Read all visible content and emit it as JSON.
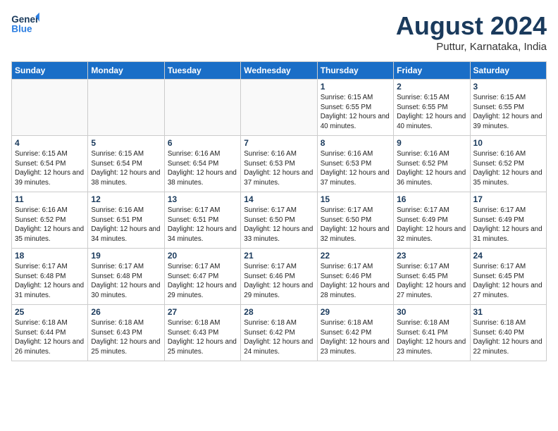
{
  "header": {
    "logo_line1": "General",
    "logo_line2": "Blue",
    "month_title": "August 2024",
    "location": "Puttur, Karnataka, India"
  },
  "days_of_week": [
    "Sunday",
    "Monday",
    "Tuesday",
    "Wednesday",
    "Thursday",
    "Friday",
    "Saturday"
  ],
  "weeks": [
    [
      {
        "day": "",
        "empty": true
      },
      {
        "day": "",
        "empty": true
      },
      {
        "day": "",
        "empty": true
      },
      {
        "day": "",
        "empty": true
      },
      {
        "day": "1",
        "sunrise": "6:15 AM",
        "sunset": "6:55 PM",
        "daylight": "12 hours and 40 minutes."
      },
      {
        "day": "2",
        "sunrise": "6:15 AM",
        "sunset": "6:55 PM",
        "daylight": "12 hours and 40 minutes."
      },
      {
        "day": "3",
        "sunrise": "6:15 AM",
        "sunset": "6:55 PM",
        "daylight": "12 hours and 39 minutes."
      }
    ],
    [
      {
        "day": "4",
        "sunrise": "6:15 AM",
        "sunset": "6:54 PM",
        "daylight": "12 hours and 39 minutes."
      },
      {
        "day": "5",
        "sunrise": "6:15 AM",
        "sunset": "6:54 PM",
        "daylight": "12 hours and 38 minutes."
      },
      {
        "day": "6",
        "sunrise": "6:16 AM",
        "sunset": "6:54 PM",
        "daylight": "12 hours and 38 minutes."
      },
      {
        "day": "7",
        "sunrise": "6:16 AM",
        "sunset": "6:53 PM",
        "daylight": "12 hours and 37 minutes."
      },
      {
        "day": "8",
        "sunrise": "6:16 AM",
        "sunset": "6:53 PM",
        "daylight": "12 hours and 37 minutes."
      },
      {
        "day": "9",
        "sunrise": "6:16 AM",
        "sunset": "6:52 PM",
        "daylight": "12 hours and 36 minutes."
      },
      {
        "day": "10",
        "sunrise": "6:16 AM",
        "sunset": "6:52 PM",
        "daylight": "12 hours and 35 minutes."
      }
    ],
    [
      {
        "day": "11",
        "sunrise": "6:16 AM",
        "sunset": "6:52 PM",
        "daylight": "12 hours and 35 minutes."
      },
      {
        "day": "12",
        "sunrise": "6:16 AM",
        "sunset": "6:51 PM",
        "daylight": "12 hours and 34 minutes."
      },
      {
        "day": "13",
        "sunrise": "6:17 AM",
        "sunset": "6:51 PM",
        "daylight": "12 hours and 34 minutes."
      },
      {
        "day": "14",
        "sunrise": "6:17 AM",
        "sunset": "6:50 PM",
        "daylight": "12 hours and 33 minutes."
      },
      {
        "day": "15",
        "sunrise": "6:17 AM",
        "sunset": "6:50 PM",
        "daylight": "12 hours and 32 minutes."
      },
      {
        "day": "16",
        "sunrise": "6:17 AM",
        "sunset": "6:49 PM",
        "daylight": "12 hours and 32 minutes."
      },
      {
        "day": "17",
        "sunrise": "6:17 AM",
        "sunset": "6:49 PM",
        "daylight": "12 hours and 31 minutes."
      }
    ],
    [
      {
        "day": "18",
        "sunrise": "6:17 AM",
        "sunset": "6:48 PM",
        "daylight": "12 hours and 31 minutes."
      },
      {
        "day": "19",
        "sunrise": "6:17 AM",
        "sunset": "6:48 PM",
        "daylight": "12 hours and 30 minutes."
      },
      {
        "day": "20",
        "sunrise": "6:17 AM",
        "sunset": "6:47 PM",
        "daylight": "12 hours and 29 minutes."
      },
      {
        "day": "21",
        "sunrise": "6:17 AM",
        "sunset": "6:46 PM",
        "daylight": "12 hours and 29 minutes."
      },
      {
        "day": "22",
        "sunrise": "6:17 AM",
        "sunset": "6:46 PM",
        "daylight": "12 hours and 28 minutes."
      },
      {
        "day": "23",
        "sunrise": "6:17 AM",
        "sunset": "6:45 PM",
        "daylight": "12 hours and 27 minutes."
      },
      {
        "day": "24",
        "sunrise": "6:17 AM",
        "sunset": "6:45 PM",
        "daylight": "12 hours and 27 minutes."
      }
    ],
    [
      {
        "day": "25",
        "sunrise": "6:18 AM",
        "sunset": "6:44 PM",
        "daylight": "12 hours and 26 minutes."
      },
      {
        "day": "26",
        "sunrise": "6:18 AM",
        "sunset": "6:43 PM",
        "daylight": "12 hours and 25 minutes."
      },
      {
        "day": "27",
        "sunrise": "6:18 AM",
        "sunset": "6:43 PM",
        "daylight": "12 hours and 25 minutes."
      },
      {
        "day": "28",
        "sunrise": "6:18 AM",
        "sunset": "6:42 PM",
        "daylight": "12 hours and 24 minutes."
      },
      {
        "day": "29",
        "sunrise": "6:18 AM",
        "sunset": "6:42 PM",
        "daylight": "12 hours and 23 minutes."
      },
      {
        "day": "30",
        "sunrise": "6:18 AM",
        "sunset": "6:41 PM",
        "daylight": "12 hours and 23 minutes."
      },
      {
        "day": "31",
        "sunrise": "6:18 AM",
        "sunset": "6:40 PM",
        "daylight": "12 hours and 22 minutes."
      }
    ]
  ]
}
